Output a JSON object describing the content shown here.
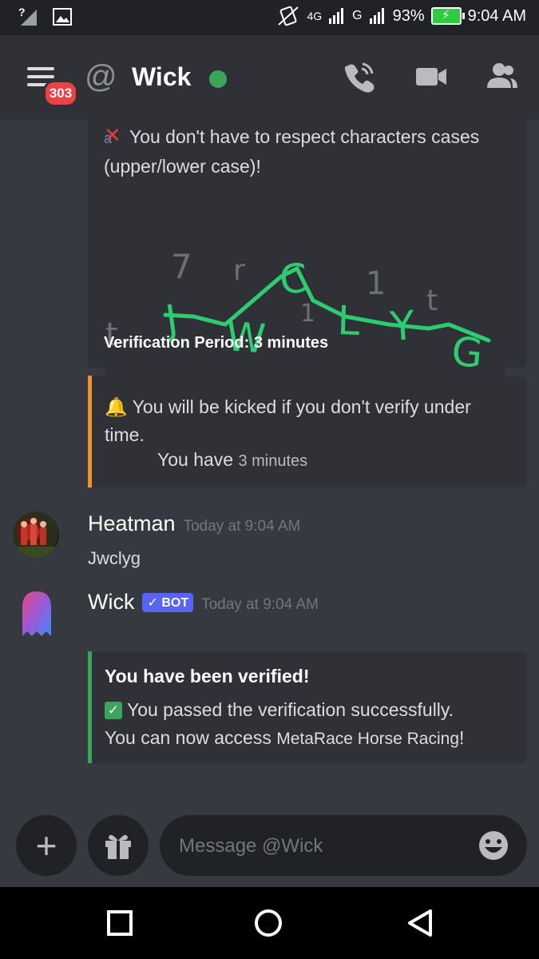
{
  "status_bar": {
    "network": "4G",
    "carrier": "G",
    "battery": "93%",
    "time": "9:04 AM"
  },
  "header": {
    "notification_count": "303",
    "title": "Wick",
    "status_color": "#3ba55c"
  },
  "captcha_embed": {
    "case_note": "You don't have to respect characters cases (upper/lower case)!",
    "case_icon_text": "a",
    "captcha_code": "JWCLYG",
    "noise_chars": [
      "7",
      "r",
      "1",
      "1",
      "t",
      "t"
    ],
    "period": "Verification Period: 3 minutes"
  },
  "warning_embed": {
    "line": "You will be kicked if you don't verify under time.",
    "you_have": "You have",
    "remaining": "3 minutes",
    "accent": "#f0932b"
  },
  "messages": [
    {
      "author": "Heatman",
      "timestamp": "Today at 9:04 AM",
      "text": "Jwclyg"
    },
    {
      "author": "Wick",
      "tag": "✓ BOT",
      "timestamp": "Today at 9:04 AM"
    }
  ],
  "verified_embed": {
    "title": "You have been verified!",
    "line1": "You passed the verification successfully.",
    "line2_prefix": "You can now access",
    "server": "MetaRace Horse Racing",
    "line2_suffix": "!",
    "accent": "#3ba55c"
  },
  "composer": {
    "placeholder": "Message @Wick"
  },
  "icons": {
    "menu": "hamburger-icon",
    "at": "at-icon",
    "call": "phone-call-icon",
    "video": "video-camera-icon",
    "members": "members-icon",
    "add": "plus-icon",
    "gift": "gift-icon",
    "emoji": "emoji-icon",
    "nav_recents": "square-icon",
    "nav_home": "circle-icon",
    "nav_back": "triangle-back-icon"
  }
}
